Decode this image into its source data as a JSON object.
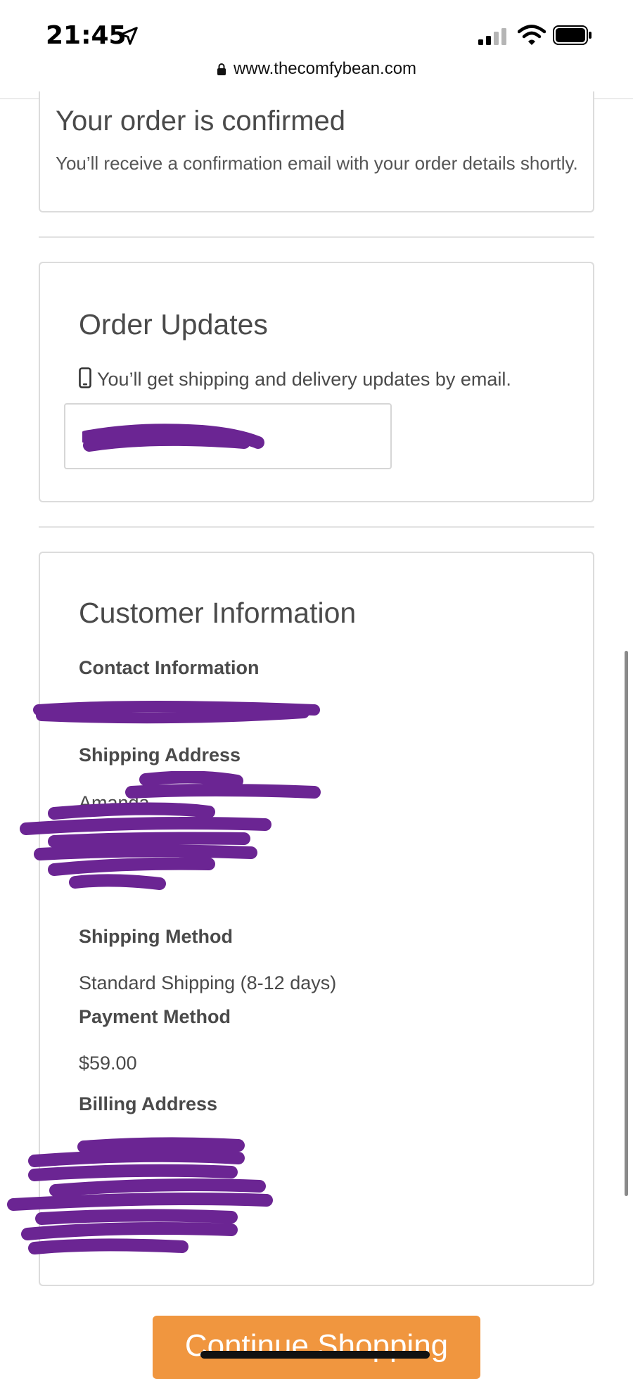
{
  "status_bar": {
    "time": "21:45",
    "icons": [
      "location-arrow-icon",
      "cell-signal-icon",
      "wifi-icon",
      "battery-icon"
    ]
  },
  "browser": {
    "url": "www.thecomfybean.com",
    "lock_icon": "lock-icon"
  },
  "confirmation": {
    "title": "Your order is confirmed",
    "text": "You’ll receive a confirmation email with your order details shortly."
  },
  "order_updates": {
    "title": "Order Updates",
    "icon": "phone-icon",
    "text": "You’ll get shipping and delivery updates by email."
  },
  "customer_info": {
    "title": "Customer Information",
    "contact_label": "Contact Information",
    "shipping_address_label": "Shipping Address",
    "shipping_address_name": "Amanda",
    "shipping_method_label": "Shipping Method",
    "shipping_method_value": "Standard Shipping (8-12 days)",
    "payment_method_label": "Payment Method",
    "payment_method_value": "$59.00",
    "billing_address_label": "Billing Address"
  },
  "actions": {
    "continue_label": "Continue Shopping"
  },
  "colors": {
    "accent": "#f0963f",
    "redaction": "#6b2593",
    "border": "#dcdcdc"
  }
}
